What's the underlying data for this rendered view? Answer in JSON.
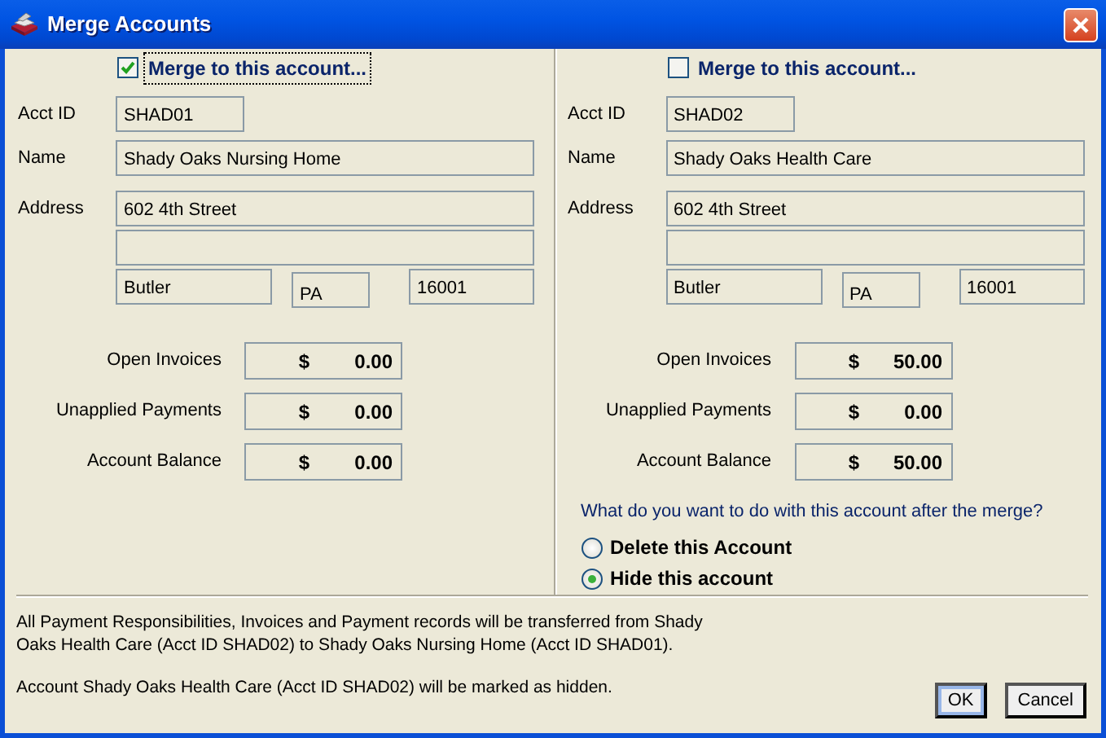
{
  "window": {
    "title": "Merge Accounts"
  },
  "accounts": [
    {
      "merge": {
        "label": "Merge to this account...",
        "checked": true,
        "focused": true
      },
      "fields": {
        "acct_id_label": "Acct ID",
        "acct_id": "SHAD01",
        "name_label": "Name",
        "name": "Shady Oaks Nursing Home",
        "address_label": "Address",
        "address_1": "602 4th Street",
        "city": "Butler",
        "state": "PA",
        "zip": "16001"
      },
      "totals": [
        {
          "label": "Open Invoices",
          "currency": "$",
          "amount": "0.00"
        },
        {
          "label": "Unapplied Payments",
          "currency": "$",
          "amount": "0.00"
        },
        {
          "label": "Account Balance",
          "currency": "$",
          "amount": "0.00"
        }
      ]
    },
    {
      "merge": {
        "label": "Merge to this account...",
        "checked": false,
        "focused": false
      },
      "fields": {
        "acct_id_label": "Acct ID",
        "acct_id": "SHAD02",
        "name_label": "Name",
        "name": "Shady Oaks Health Care",
        "address_label": "Address",
        "address_1": "602 4th Street",
        "city": "Butler",
        "state": "PA",
        "zip": "16001"
      },
      "totals": [
        {
          "label": "Open Invoices",
          "currency": "$",
          "amount": "50.00"
        },
        {
          "label": "Unapplied Payments",
          "currency": "$",
          "amount": "0.00"
        },
        {
          "label": "Account Balance",
          "currency": "$",
          "amount": "50.00"
        }
      ],
      "after_merge": {
        "question": "What do you want to do with this account after the merge?",
        "options": [
          {
            "label": "Delete this Account",
            "selected": false
          },
          {
            "label": "Hide this account",
            "selected": true
          }
        ]
      }
    }
  ],
  "messages": [
    "All Payment Responsibilities, Invoices and Payment records will be transferred from Shady Oaks Health Care (Acct ID SHAD02) to Shady Oaks Nursing Home (Acct ID SHAD01).",
    "Account Shady Oaks Health Care (Acct ID SHAD02) will be marked as hidden."
  ],
  "buttons": [
    {
      "label": "OK",
      "default": true
    },
    {
      "label": "Cancel",
      "default": false
    }
  ]
}
